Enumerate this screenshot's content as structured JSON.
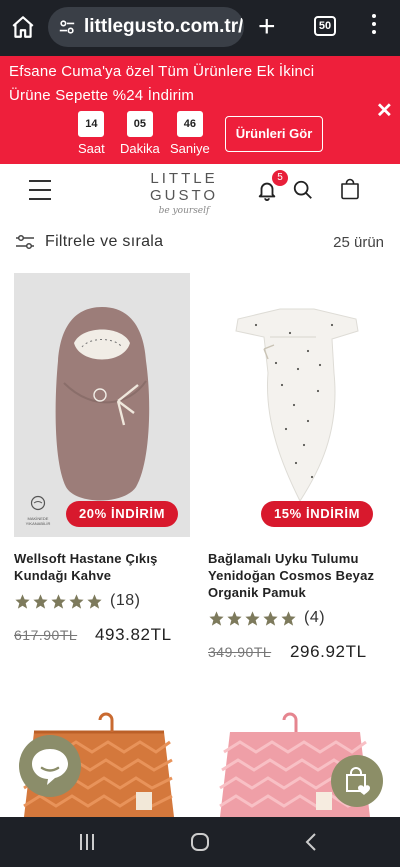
{
  "browser": {
    "url": "littlegusto.com.tr/c",
    "tab_count": "50",
    "home_icon": "home-icon",
    "new_tab_icon": "plus-icon",
    "menu_icon": "kebab-menu-icon"
  },
  "promo": {
    "message": "Efsane Cuma'ya özel Tüm Ürünlere Ek İkinci Ürüne Sepette %24 İndirim",
    "countdown": [
      {
        "value": "14",
        "label": "Saat"
      },
      {
        "value": "05",
        "label": "Dakika"
      },
      {
        "value": "46",
        "label": "Saniye"
      }
    ],
    "cta_label": "Ürünleri Gör",
    "bg_color": "#ee1f3b"
  },
  "header": {
    "logo_text": "LITTLE GUSTO",
    "logo_tagline": "be yourself",
    "notification_count": "5"
  },
  "filter": {
    "label": "Filtrele ve sırala",
    "result_count": "25 ürün"
  },
  "products": [
    {
      "badge": "20% İNDİRİM",
      "name": "Wellsoft Hastane Çıkış Kundağı Kahve",
      "rating": 5,
      "review_count": "(18)",
      "old_price": "617.90TL",
      "new_price": "493.82TL",
      "cert_label": "MAKİNEDE YIKANABİLİR"
    },
    {
      "badge": "15% İNDİRİM",
      "name": "Bağlamalı Uyku Tulumu Yenidoğan Cosmos Beyaz Organik Pamuk",
      "rating": 5,
      "review_count": "(4)",
      "old_price": "349.90TL",
      "new_price": "296.92TL"
    }
  ],
  "colors": {
    "badge": "#d8192d",
    "star": "#7d7a5c",
    "fab": "#8c8e67"
  }
}
